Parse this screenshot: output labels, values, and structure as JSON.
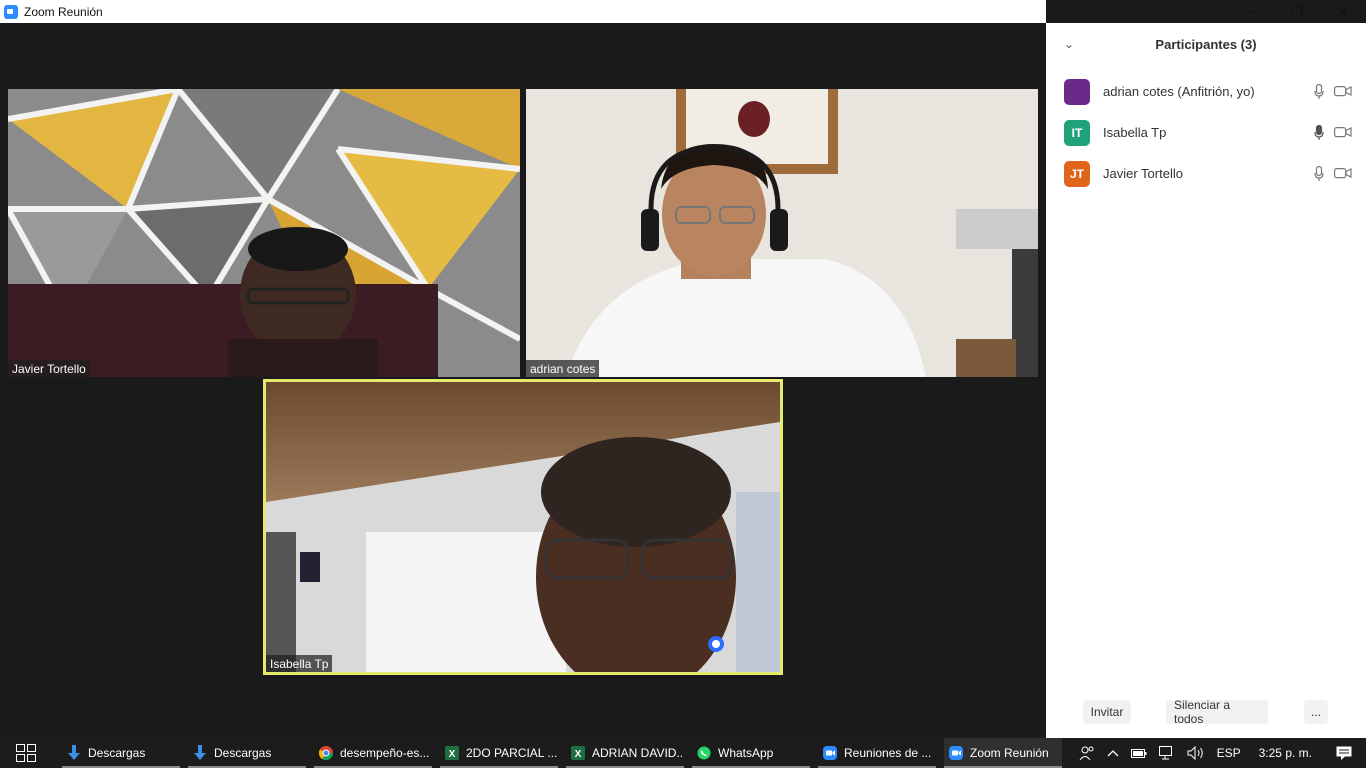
{
  "window": {
    "title": "Zoom Reunión"
  },
  "window_controls": {
    "minimize": "—",
    "restore": "❐",
    "close": "✕"
  },
  "videos": [
    {
      "name": "Javier Tortello"
    },
    {
      "name": "adrian cotes"
    },
    {
      "name": "Isabella Tp"
    }
  ],
  "sidebar": {
    "title": "Participantes (3)",
    "participants": [
      {
        "initials": "",
        "name": "adrian cotes (Anfitrión, yo)",
        "color": "#6b2a8a"
      },
      {
        "initials": "IT",
        "name": "Isabella Tp",
        "color": "#1fa27a"
      },
      {
        "initials": "JT",
        "name": "Javier Tortello",
        "color": "#e0641a"
      }
    ],
    "buttons": {
      "invite": "Invitar",
      "mute_all": "Silenciar a todos",
      "more": "..."
    }
  },
  "taskbar": {
    "items": [
      {
        "label": "Descargas",
        "icon": "download-icon"
      },
      {
        "label": "Descargas",
        "icon": "download-icon"
      },
      {
        "label": "desempeño-es...",
        "icon": "chrome-icon"
      },
      {
        "label": "2DO PARCIAL ...",
        "icon": "excel-icon"
      },
      {
        "label": "ADRIAN DAVID...",
        "icon": "excel-icon"
      },
      {
        "label": "WhatsApp",
        "icon": "whatsapp-icon"
      },
      {
        "label": "Reuniones de ...",
        "icon": "zoom-icon"
      },
      {
        "label": "Zoom Reunión",
        "icon": "zoom-icon"
      }
    ],
    "tray": {
      "language": "ESP",
      "time": "3:25 p. m."
    }
  }
}
